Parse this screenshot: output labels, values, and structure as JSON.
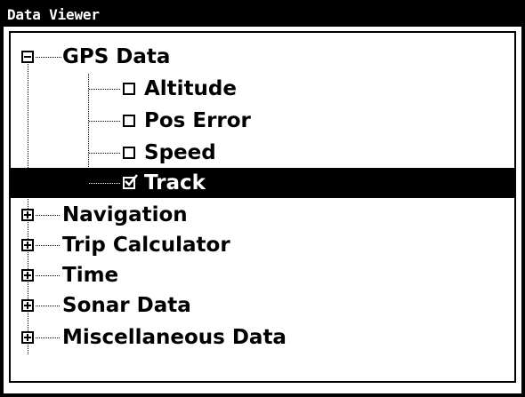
{
  "window": {
    "title": "Data Viewer"
  },
  "tree": {
    "gps_data": {
      "label": "GPS Data",
      "expanded": true,
      "children": [
        {
          "label": "Altitude",
          "checked": false
        },
        {
          "label": "Pos Error",
          "checked": false
        },
        {
          "label": "Speed",
          "checked": false
        },
        {
          "label": "Track",
          "checked": true,
          "selected": true
        }
      ]
    },
    "collapsed": [
      {
        "label": "Navigation"
      },
      {
        "label": "Trip Calculator"
      },
      {
        "label": "Time"
      },
      {
        "label": "Sonar Data"
      },
      {
        "label": "Miscellaneous Data"
      }
    ]
  },
  "colors": {
    "foreground": "#000000",
    "background": "#ffffff",
    "selection": "#000000"
  }
}
